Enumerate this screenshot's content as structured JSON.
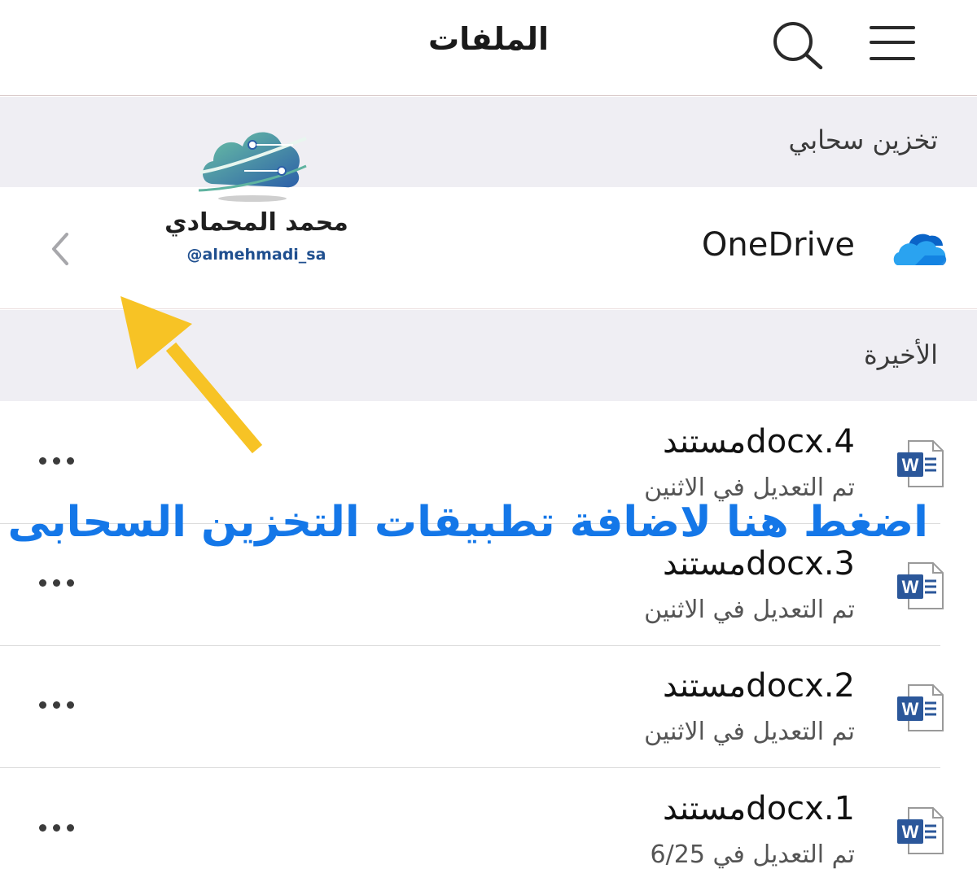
{
  "header": {
    "title": "الملفات"
  },
  "sections": {
    "cloud_storage": "تخزين سحابي",
    "recent": "الأخيرة"
  },
  "onedrive": {
    "label": "OneDrive"
  },
  "files": [
    {
      "name": "مستندdocx.4",
      "modified": "تم التعديل في الاثنين"
    },
    {
      "name": "مستندdocx.3",
      "modified": "تم التعديل في الاثنين"
    },
    {
      "name": "مستندdocx.2",
      "modified": "تم التعديل في الاثنين"
    },
    {
      "name": "مستندdocx.1",
      "modified": "تم التعديل في 6/25"
    }
  ],
  "watermark": {
    "name": "محمد المحمادي",
    "handle": "@almehmadi_sa"
  },
  "annotation": {
    "text": "اضغط هنا لاضافة تطبيقات التخزين السحابى"
  },
  "icons": {
    "menu": "hamburger-icon",
    "search": "search-icon",
    "onedrive": "onedrive-cloud-icon",
    "chevron": "chevron-left-icon",
    "word": "word-document-icon",
    "more": "more-horizontal-icon"
  },
  "colors": {
    "section_bg": "#efeef3",
    "annotation": "#1477e8",
    "arrow": "#f7c325",
    "onedrive_blue": "#0f78d4",
    "word_blue": "#2b579a"
  }
}
